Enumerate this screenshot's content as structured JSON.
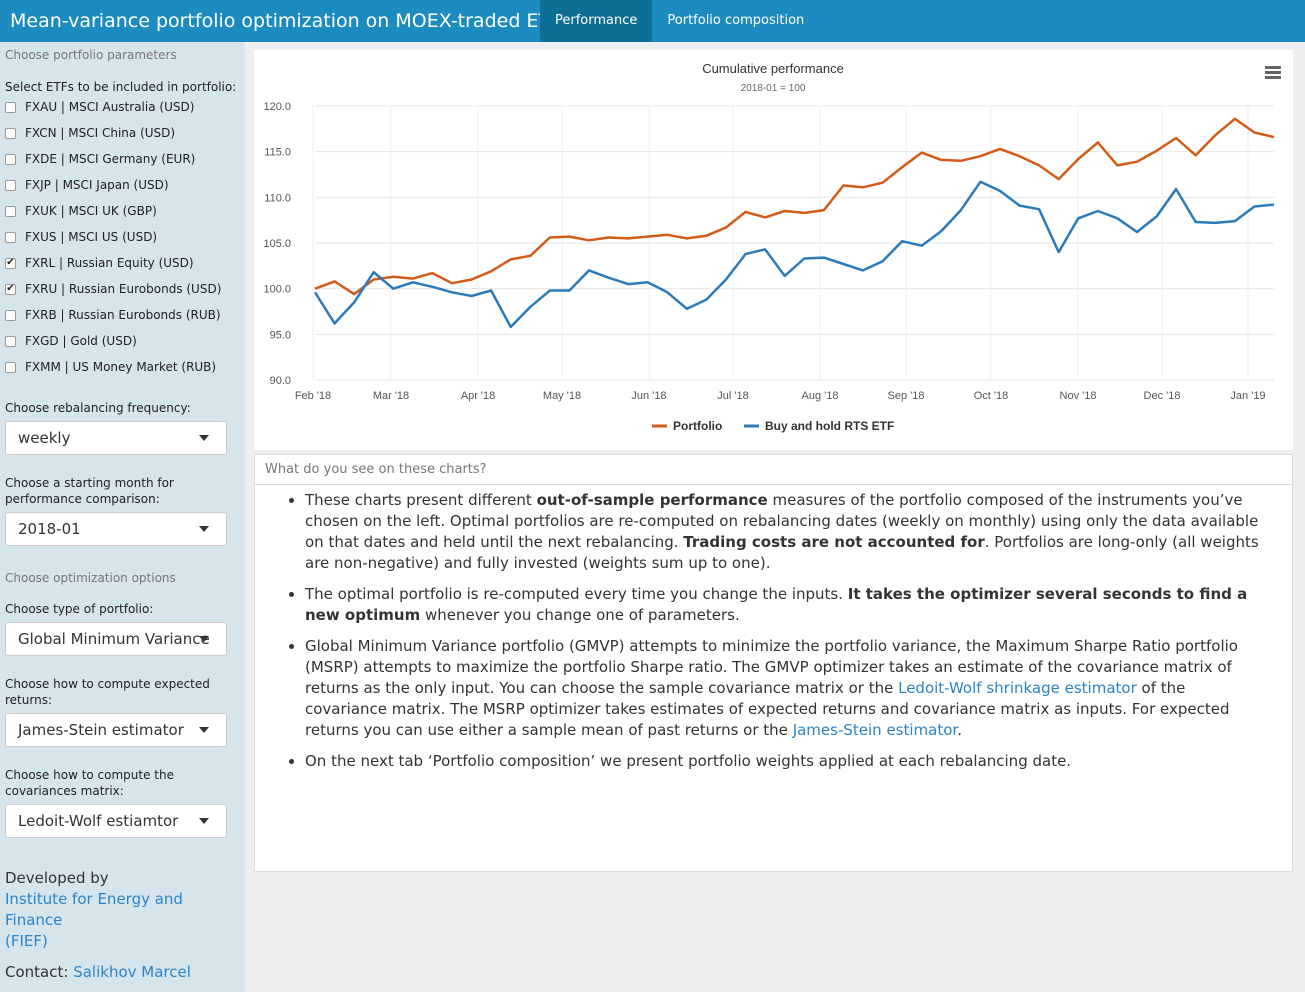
{
  "header": {
    "title": "Mean-variance portfolio optimization on MOEX-traded ETFs",
    "tabs": [
      {
        "label": "Performance",
        "active": true
      },
      {
        "label": "Portfolio composition",
        "active": false
      }
    ],
    "bg_color": "#1c8cc0"
  },
  "sidebar": {
    "params_title": "Choose portfolio parameters",
    "etf_label": "Select ETFs to be included in portfolio:",
    "etfs": [
      {
        "label": "FXAU | MSCI Australia (USD)",
        "checked": false
      },
      {
        "label": "FXCN | MSCI China (USD)",
        "checked": false
      },
      {
        "label": "FXDE | MSCI Germany (EUR)",
        "checked": false
      },
      {
        "label": "FXJP | MSCI Japan (USD)",
        "checked": false
      },
      {
        "label": "FXUK | MSCI UK (GBP)",
        "checked": false
      },
      {
        "label": "FXUS | MSCI US (USD)",
        "checked": false
      },
      {
        "label": "FXRL | Russian Equity (USD)",
        "checked": true
      },
      {
        "label": "FXRU | Russian Eurobonds (USD)",
        "checked": true
      },
      {
        "label": "FXRB | Russian Eurobonds (RUB)",
        "checked": false
      },
      {
        "label": "FXGD | Gold (USD)",
        "checked": false
      },
      {
        "label": "FXMM | US Money Market (RUB)",
        "checked": false
      }
    ],
    "rebalancing_label": "Choose rebalancing frequency:",
    "rebalancing_value": "weekly",
    "start_label_1": "Choose a starting month for",
    "start_label_2": "performance comparison:",
    "start_value": "2018-01",
    "opt_title": "Choose optimization options",
    "portfolio_type_label": "Choose type of portfolio:",
    "portfolio_type_value": "Global Minimum Variance",
    "returns_label_1": "Choose how to compute expected",
    "returns_label_2": "returns:",
    "returns_value": "James-Stein estimator",
    "cov_label_1": "Choose how to compute the",
    "cov_label_2": "covariances matrix:",
    "cov_value": "Ledoit-Wolf estiamtor",
    "developed_by": "Developed by",
    "institute_1": "Institute for Energy and Finance",
    "institute_2": "(FIEF)",
    "contact_label": "Contact:",
    "contact_name": "Salikhov Marcel"
  },
  "chart_data": {
    "type": "line",
    "title": "Cumulative performance",
    "subtitle": "2018-01 = 100",
    "xlabel": "",
    "ylabel": "",
    "ylim": [
      90,
      120
    ],
    "yticks": [
      "90.0",
      "95.0",
      "100.0",
      "105.0",
      "110.0",
      "115.0",
      "120.0"
    ],
    "xticks": [
      "Feb '18",
      "Mar '18",
      "Apr '18",
      "May '18",
      "Jun '18",
      "Jul '18",
      "Aug '18",
      "Sep '18",
      "Oct '18",
      "Nov '18",
      "Dec '18",
      "Jan '19"
    ],
    "grid": true,
    "legend": "bottom",
    "series": [
      {
        "name": "Portfolio",
        "color": "#d35a17",
        "values": [
          100.0,
          100.8,
          99.4,
          101.0,
          101.3,
          101.1,
          101.7,
          100.6,
          101.0,
          101.9,
          103.2,
          103.6,
          105.6,
          105.7,
          105.3,
          105.6,
          105.5,
          105.7,
          105.9,
          105.5,
          105.8,
          106.7,
          108.4,
          107.8,
          108.5,
          108.3,
          108.6,
          111.3,
          111.1,
          111.6,
          113.3,
          114.9,
          114.1,
          114.0,
          114.5,
          115.3,
          114.5,
          113.5,
          112.0,
          114.2,
          116.0,
          113.5,
          113.9,
          115.1,
          116.5,
          114.6,
          116.8,
          118.6,
          117.1,
          116.6
        ]
      },
      {
        "name": "Buy and hold RTS ETF",
        "color": "#2b7bba",
        "values": [
          99.6,
          96.2,
          98.5,
          101.8,
          100.0,
          100.7,
          100.2,
          99.6,
          99.2,
          99.8,
          95.8,
          98.0,
          99.8,
          99.8,
          102.0,
          101.2,
          100.5,
          100.7,
          99.6,
          97.8,
          98.8,
          101.0,
          103.8,
          104.3,
          101.4,
          103.3,
          103.4,
          102.7,
          102.0,
          103.0,
          105.2,
          104.7,
          106.3,
          108.6,
          111.7,
          110.7,
          109.1,
          108.7,
          104.0,
          107.7,
          108.5,
          107.7,
          106.2,
          107.9,
          110.9,
          107.3,
          107.2,
          107.4,
          109.0,
          109.2
        ]
      }
    ]
  },
  "info": {
    "title": "What do you see on these charts?",
    "b1_a": "These charts present different ",
    "b1_b": "out-of-sample performance",
    "b1_c": " measures of the portfolio composed of the instruments you’ve chosen on the left. Optimal portfolios are re-computed on rebalancing dates (weekly on monthly) using only the data available on that dates and held until the next rebalancing. ",
    "b1_d": "Trading costs are not accounted for",
    "b1_e": ". Portfolios are long-only (all weights are non-negative) and fully invested (weights sum up to one).",
    "b2_a": "The optimal portfolio is re-computed every time you change the inputs. ",
    "b2_b": "It takes the optimizer several seconds to find a new optimum",
    "b2_c": " whenever you change one of parameters.",
    "b3_a": "Global Minimum Variance portfolio (GMVP) attempts to minimize the portfolio variance, the Maximum Sharpe Ratio portfolio (MSRP) attempts to maximize the portfolio Sharpe ratio. The GMVP optimizer takes an estimate of the covariance matrix of returns as the only input. You can choose the sample covariance matrix or the ",
    "b3_link1": "Ledoit-Wolf shrinkage estimator",
    "b3_b": " of the covariance matrix. The MSRP optimizer takes estimates of expected returns and covariance matrix as inputs. For expected returns you can use either a sample mean of past returns or the ",
    "b3_link2": "James-Stein estimator",
    "b3_c": ".",
    "b4": "On the next tab ‘Portfolio composition’ we present portfolio weights applied at each rebalancing date."
  }
}
